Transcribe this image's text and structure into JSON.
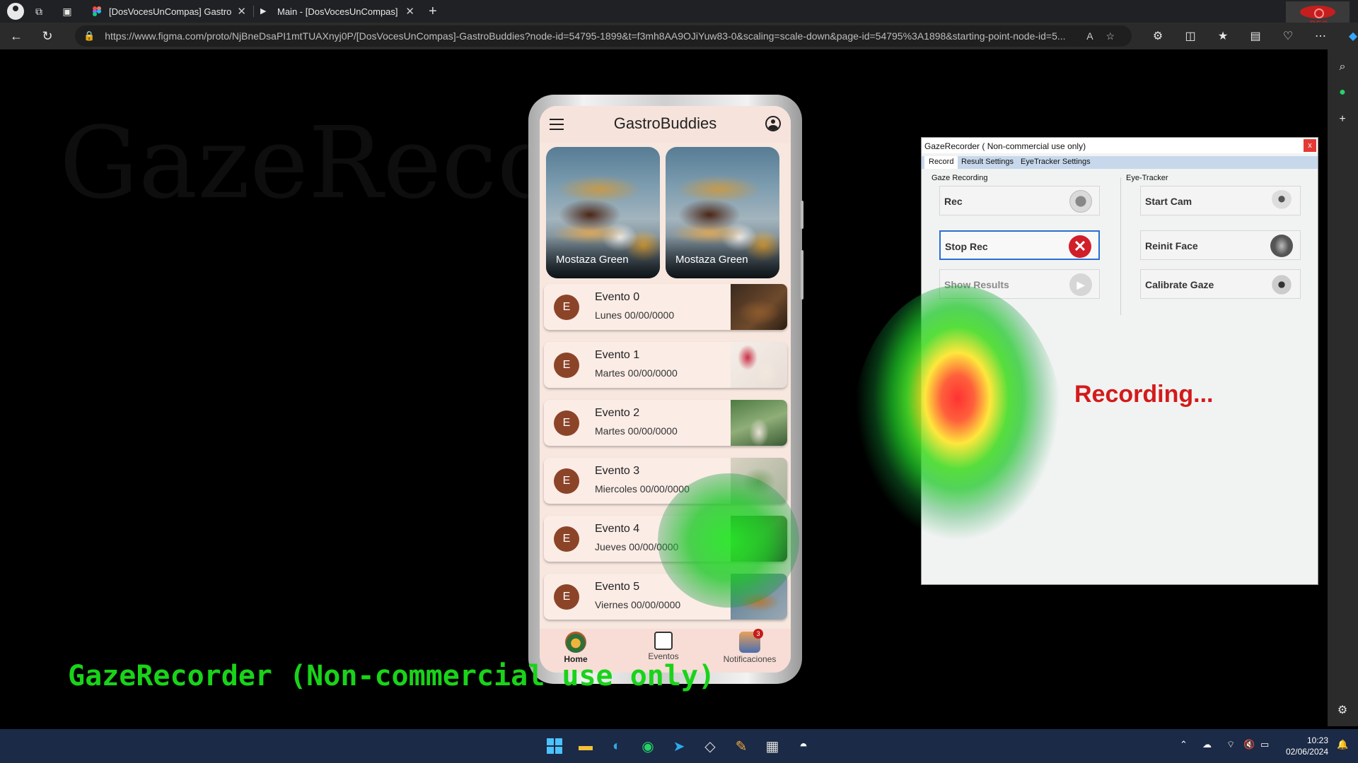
{
  "browser": {
    "tabs": [
      {
        "title": "[DosVocesUnCompas] GastroBuddies",
        "active": false
      },
      {
        "title": "Main - [DosVocesUnCompas] GastroBuddies",
        "active": true
      }
    ],
    "url": "https://www.figma.com/proto/NjBneDsaPI1mtTUAXnyj0P/[DosVocesUnCompas]-GastroBuddies?node-id=54795-1899&t=f3mh8AA9OJiYuw83-0&scaling=scale-down&page-id=54795%3A1898&starting-point-node-id=5...",
    "rec_badge": "REC"
  },
  "watermark": "GazeRecorder",
  "app": {
    "title": "GastroBuddies",
    "cards": [
      {
        "label": "Mostaza Green"
      },
      {
        "label": "Mostaza Green"
      }
    ],
    "events": [
      {
        "avatar": "E",
        "title": "Evento 0",
        "date": "Lunes 00/00/0000"
      },
      {
        "avatar": "E",
        "title": "Evento 1",
        "date": "Martes 00/00/0000"
      },
      {
        "avatar": "E",
        "title": "Evento 2",
        "date": "Martes 00/00/0000"
      },
      {
        "avatar": "E",
        "title": "Evento 3",
        "date": "Miercoles 00/00/0000"
      },
      {
        "avatar": "E",
        "title": "Evento 4",
        "date": "Jueves 00/00/0000"
      },
      {
        "avatar": "E",
        "title": "Evento 5",
        "date": "Viernes 00/00/0000"
      }
    ],
    "nav": [
      {
        "label": "Home",
        "icon": "home-icon",
        "active": true
      },
      {
        "label": "Eventos",
        "icon": "calendar-icon",
        "active": false
      },
      {
        "label": "Notificaciones",
        "icon": "bell-icon",
        "badge": "3",
        "active": false
      }
    ]
  },
  "overlay_text": "GazeRecorder (Non-commercial use only)",
  "gazerecorder": {
    "title": "GazeRecorder   ( Non-commercial use only)",
    "close": "x",
    "tabs": [
      "Record",
      "Result Settings",
      "EyeTracker Settings"
    ],
    "groups": {
      "gaze": "Gaze Recording",
      "eye": "Eye-Tracker"
    },
    "buttons": {
      "rec": "Rec",
      "stop_rec": "Stop Rec",
      "show_results": "Show Results",
      "start_cam": "Start Cam",
      "reinit_face": "Reinit Face",
      "calibrate_gaze": "Calibrate Gaze"
    },
    "status": "Recording..."
  },
  "taskbar": {
    "time": "10:23",
    "date": "02/06/2024"
  },
  "colors": {
    "accent_brown": "#8c4429",
    "recording_red": "#d41a1a",
    "overlay_green": "#19d319"
  }
}
